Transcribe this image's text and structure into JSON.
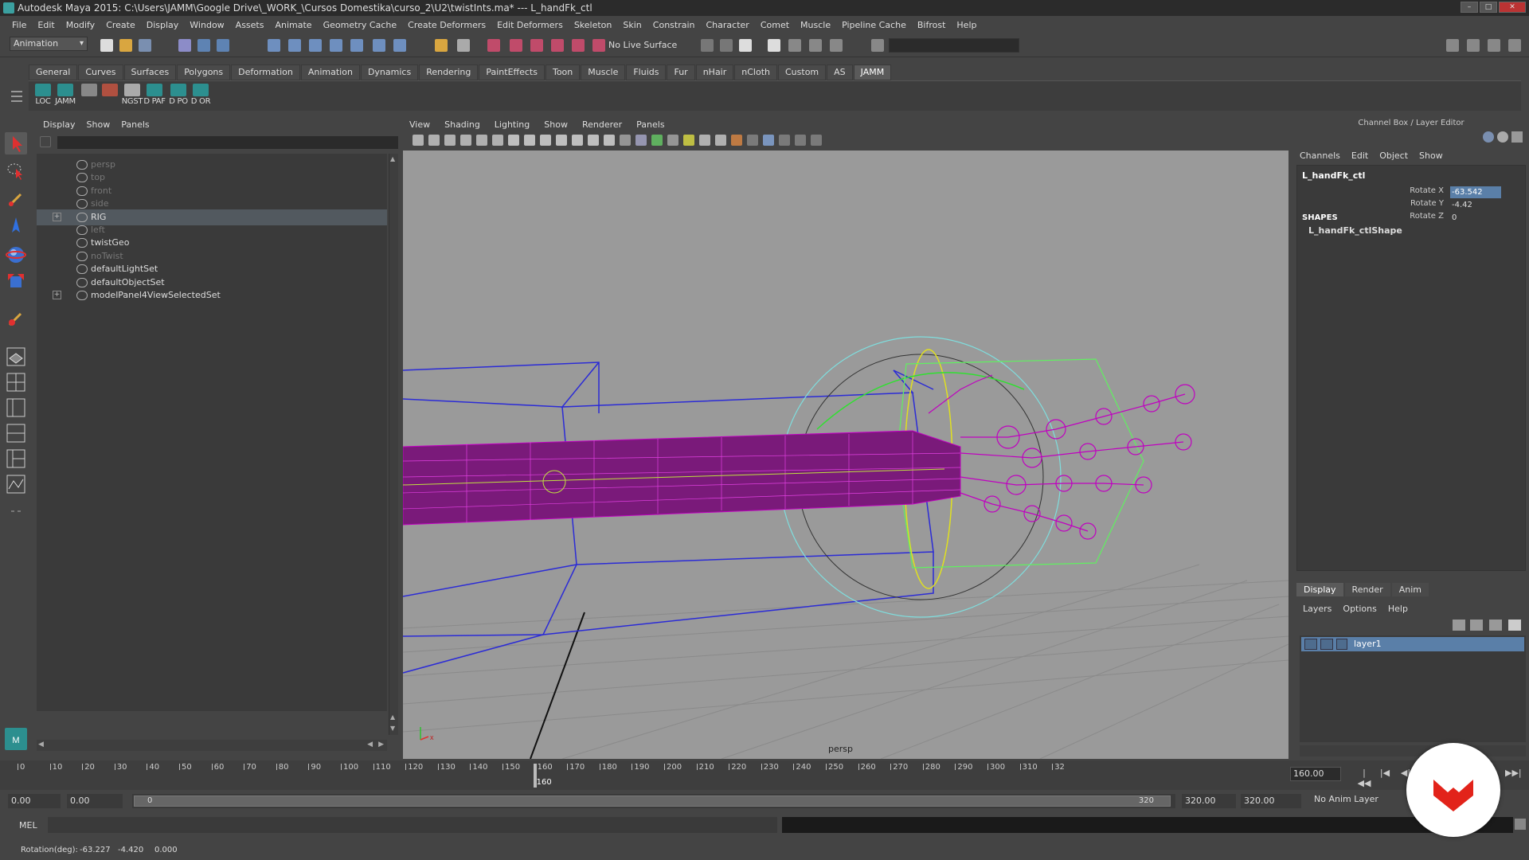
{
  "window": {
    "title": "Autodesk Maya 2015: C:\\Users\\JAMM\\Google Drive\\_WORK_\\Cursos Domestika\\curso_2\\U2\\twistInts.ma*   ---   L_handFk_ctl"
  },
  "menubar": [
    "File",
    "Edit",
    "Modify",
    "Create",
    "Display",
    "Window",
    "Assets",
    "Animate",
    "Geometry Cache",
    "Create Deformers",
    "Edit Deformers",
    "Skeleton",
    "Skin",
    "Constrain",
    "Character",
    "Comet",
    "Muscle",
    "Pipeline Cache",
    "Bifrost",
    "Help"
  ],
  "statusline": {
    "mode": "Animation",
    "live_surface": "No Live Surface"
  },
  "shelf": {
    "tabs": [
      "General",
      "Curves",
      "Surfaces",
      "Polygons",
      "Deformation",
      "Animation",
      "Dynamics",
      "Rendering",
      "PaintEffects",
      "Toon",
      "Muscle",
      "Fluids",
      "Fur",
      "nHair",
      "nCloth",
      "Custom",
      "AS",
      "JAMM"
    ],
    "active_tab": "JAMM",
    "buttons": [
      "LOC",
      "JAMM",
      "",
      "",
      "NGST",
      "D PAF",
      "D PO",
      "D OR"
    ]
  },
  "outliner": {
    "menus": [
      "Display",
      "Show",
      "Panels"
    ],
    "items": [
      {
        "name": "persp",
        "dim": true,
        "expand": false
      },
      {
        "name": "top",
        "dim": true,
        "expand": false
      },
      {
        "name": "front",
        "dim": true,
        "expand": false
      },
      {
        "name": "side",
        "dim": true,
        "expand": false
      },
      {
        "name": "RIG",
        "dim": false,
        "expand": true,
        "selected": true
      },
      {
        "name": "left",
        "dim": true,
        "expand": false
      },
      {
        "name": "twistGeo",
        "dim": false,
        "expand": false
      },
      {
        "name": "noTwist",
        "dim": true,
        "expand": false
      },
      {
        "name": "defaultLightSet",
        "dim": false,
        "expand": false
      },
      {
        "name": "defaultObjectSet",
        "dim": false,
        "expand": false
      },
      {
        "name": "modelPanel4ViewSelectedSet",
        "dim": false,
        "expand": true
      }
    ]
  },
  "viewport": {
    "menus": [
      "View",
      "Shading",
      "Lighting",
      "Show",
      "Renderer",
      "Panels"
    ],
    "camera_label": "persp"
  },
  "channelbox": {
    "title": "Channel Box / Layer Editor",
    "menus": [
      "Channels",
      "Edit",
      "Object",
      "Show"
    ],
    "object_name": "L_handFk_ctl",
    "attributes": [
      {
        "name": "Rotate X",
        "value": "-63.542",
        "highlighted": true
      },
      {
        "name": "Rotate Y",
        "value": "-4.42",
        "highlighted": false
      },
      {
        "name": "Rotate Z",
        "value": "0",
        "highlighted": false
      }
    ],
    "shapes_header": "SHAPES",
    "shape_name": "L_handFk_ctlShape"
  },
  "layer_editor": {
    "tabs": [
      "Display",
      "Render",
      "Anim"
    ],
    "active_tab": "Display",
    "menus": [
      "Layers",
      "Options",
      "Help"
    ],
    "layers": [
      {
        "name": "layer1"
      }
    ]
  },
  "timeslider": {
    "ticks": [
      "0",
      "10",
      "20",
      "30",
      "40",
      "50",
      "60",
      "70",
      "80",
      "90",
      "100",
      "110",
      "120",
      "130",
      "140",
      "150",
      "160",
      "170",
      "180",
      "190",
      "200",
      "210",
      "220",
      "230",
      "240",
      "250",
      "260",
      "270",
      "280",
      "290",
      "300",
      "310",
      "32"
    ],
    "current_frame": "160",
    "current_frame_field": "160.00"
  },
  "rangeslider": {
    "start": "0.00",
    "start2": "0.00",
    "range_start_label": "0",
    "range_end_label": "320",
    "end": "320.00",
    "end2": "320.00",
    "anim_layer": "No Anim Layer"
  },
  "cmdline": {
    "label": "MEL"
  },
  "helpline": {
    "label": "Rotation(deg):",
    "x": "-63.227",
    "y": "-4.420",
    "z": "0.000"
  },
  "colors": {
    "scene_bg": "#9a9a9a",
    "selection_blue": "#5a7fa8",
    "magenta": "#c000c0",
    "wire_blue": "#2b2bd6"
  }
}
